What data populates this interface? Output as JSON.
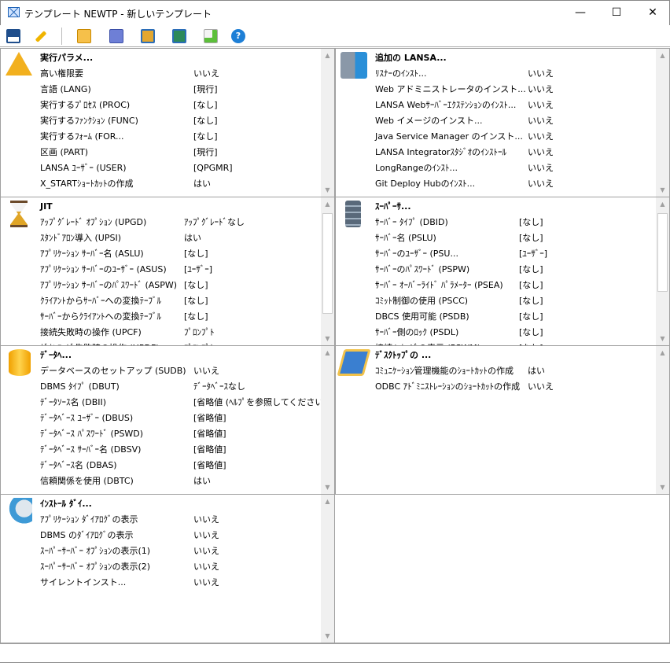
{
  "window": {
    "title": "テンプレート NEWTP - 新しいテンプレート",
    "minimize": "—",
    "maximize": "☐",
    "close": "✕"
  },
  "toolbar": [
    "save",
    "edit",
    "browse-folder",
    "settings",
    "image",
    "run",
    "new-document",
    "help"
  ],
  "panels": [
    {
      "title": "実行パラメ...",
      "icon": "warning-icon",
      "rows": [
        [
          "高い権限要",
          "いいえ"
        ],
        [
          "言語 (LANG)",
          "[現行]"
        ],
        [
          "実行するﾌﾟﾛｾｽ (PROC)",
          "[なし]"
        ],
        [
          "実行するﾌｧﾝｸｼｮﾝ (FUNC)",
          "[なし]"
        ],
        [
          "実行するﾌｫｰﾑ (FOR...",
          "[なし]"
        ],
        [
          "区画 (PART)",
          "[現行]"
        ],
        [
          "LANSA ﾕｰｻﾞｰ (USER)",
          "[QPGMR]"
        ],
        [
          "X_STARTｼｮｰﾄｶｯﾄの作成",
          "はい"
        ]
      ]
    },
    {
      "title": "追加の LANSA...",
      "icon": "server-network-icon",
      "rows": [
        [
          "ﾘｽﾅｰのｲﾝｽﾄ...",
          "いいえ"
        ],
        [
          "Web アドミニストレータのインスト...",
          "いいえ"
        ],
        [
          "LANSA Webｻｰﾊﾞｰｴｸｽﾃﾝｼｮﾝのｲﾝｽﾄ...",
          "いいえ"
        ],
        [
          "Web イメージのインスト...",
          "いいえ"
        ],
        [
          "Java Service Manager のインスト...",
          "いいえ"
        ],
        [
          "LANSA Integratorｽﾀｼﾞｵのｲﾝｽﾄｰﾙ",
          "いいえ"
        ],
        [
          "LongRangeのｲﾝｽﾄ...",
          "いいえ"
        ],
        [
          "Git Deploy Hubのｲﾝｽﾄ...",
          "いいえ"
        ]
      ]
    },
    {
      "title": "JIT",
      "icon": "hourglass-icon",
      "rows": [
        [
          "ｱｯﾌﾟｸﾞﾚｰﾄﾞ ｵﾌﾟｼｮﾝ (UPGD)",
          "ｱｯﾌﾟｸﾞﾚｰﾄﾞなし"
        ],
        [
          "ｽﾀﾝﾄﾞｱﾛﾝ導入 (UPSI)",
          "はい"
        ],
        [
          "ｱﾌﾟﾘｹｰｼｮﾝ ｻｰﾊﾞｰ名 (ASLU)",
          "[なし]"
        ],
        [
          "ｱﾌﾟﾘｹｰｼｮﾝ ｻｰﾊﾞｰのﾕｰｻﾞｰ (ASUS)",
          "[ﾕｰｻﾞｰ]"
        ],
        [
          "ｱﾌﾟﾘｹｰｼｮﾝ ｻｰﾊﾞｰのﾊﾟｽﾜｰﾄﾞ (ASPW)",
          "[なし]"
        ],
        [
          "ｸﾗｲｱﾝﾄからｻｰﾊﾞｰへの変換ﾃｰﾌﾞﾙ",
          "[なし]"
        ],
        [
          "ｻｰﾊﾞｰからｸﾗｲｱﾝﾄへの変換ﾃｰﾌﾞﾙ",
          "[なし]"
        ],
        [
          "接続失敗時の操作 (UPCF)",
          "ﾌﾟﾛﾝﾌﾟﾄ"
        ],
        [
          "ﾀﾞｳﾝﾛｰﾄﾞ失敗時の操作 (UPDF)",
          "ﾌﾟﾛﾝﾌﾟﾄ"
        ]
      ]
    },
    {
      "title": "ｽｰﾊﾟｰｻ...",
      "icon": "server-icon",
      "rows": [
        [
          "ｻｰﾊﾞｰ ﾀｲﾌﾟ (DBID)",
          "[なし]"
        ],
        [
          "ｻｰﾊﾞｰ名 (PSLU)",
          "[なし]"
        ],
        [
          "ｻｰﾊﾞｰのﾕｰｻﾞｰ (PSU...",
          "[ﾕｰｻﾞｰ]"
        ],
        [
          "ｻｰﾊﾞｰのﾊﾟｽﾜｰﾄﾞ (PSPW)",
          "[なし]"
        ],
        [
          "ｻｰﾊﾞｰ ｵｰﾊﾞｰﾗｲﾄﾞ ﾊﾟﾗﾒｰﾀｰ (PSEA)",
          "[なし]"
        ],
        [
          "ｺﾐｯﾄ制御の使用 (PSCC)",
          "[なし]"
        ],
        [
          "DBCS 使用可能 (PSDB)",
          "[なし]"
        ],
        [
          "ｻｰﾊﾞｰ側のﾛｯｸ (PSDL)",
          "[なし]"
        ],
        [
          "接続ﾒｯｾｰｼﾞの表示 (PSWM)",
          "[なし]"
        ]
      ]
    },
    {
      "title": "ﾃﾞｰﾀﾍ...",
      "icon": "database-icon",
      "rows": [
        [
          "データベースのセットアップ (SUDB)",
          "いいえ"
        ],
        [
          "DBMS ﾀｲﾌﾟ (DBUT)",
          "ﾃﾞｰﾀﾍﾞｰｽなし"
        ],
        [
          "ﾃﾞｰﾀｿｰｽ名 (DBII)",
          "[省略値 (ﾍﾙﾌﾟを参照してください)]"
        ],
        [
          "ﾃﾞｰﾀﾍﾞｰｽ ﾕｰｻﾞｰ (DBUS)",
          "[省略値]"
        ],
        [
          "ﾃﾞｰﾀﾍﾞｰｽ ﾊﾟｽﾜｰﾄﾞ (PSWD)",
          "[省略値]"
        ],
        [
          "ﾃﾞｰﾀﾍﾞｰｽ ｻｰﾊﾞｰ名 (DBSV)",
          "[省略値]"
        ],
        [
          "ﾃﾞｰﾀﾍﾞｰｽ名 (DBAS)",
          "[省略値]"
        ],
        [
          "信頼関係を使用 (DBTC)",
          "はい"
        ]
      ]
    },
    {
      "title": "ﾃﾞｽｸﾄｯﾌﾟの ...",
      "icon": "desktop-pen-icon",
      "rows": [
        [
          "ｺﾐｭﾆｹｰｼｮﾝ管理機能のｼｮｰﾄｶｯﾄの作成",
          "はい"
        ],
        [
          "ODBC ｱﾄﾞﾐﾆｽﾄﾚｰｼｮﾝのｼｮｰﾄｶｯﾄの作成",
          "いいえ"
        ]
      ]
    },
    {
      "title": "ｲﾝｽﾄｰﾙ ﾀﾞｲ...",
      "icon": "install-disc-icon",
      "rows": [
        [
          "ｱﾌﾟﾘｹｰｼｮﾝ ﾀﾞｲｱﾛｸﾞの表示",
          "いいえ"
        ],
        [
          "DBMS のﾀﾞｲｱﾛｸﾞの表示",
          "いいえ"
        ],
        [
          "ｽｰﾊﾟｰｻｰﾊﾞｰ ｵﾌﾟｼｮﾝの表示(1)",
          "いいえ"
        ],
        [
          "ｽｰﾊﾟｰｻｰﾊﾞｰ ｵﾌﾟｼｮﾝの表示(2)",
          "いいえ"
        ],
        [
          "サイレントインスト...",
          "いいえ"
        ]
      ]
    }
  ]
}
